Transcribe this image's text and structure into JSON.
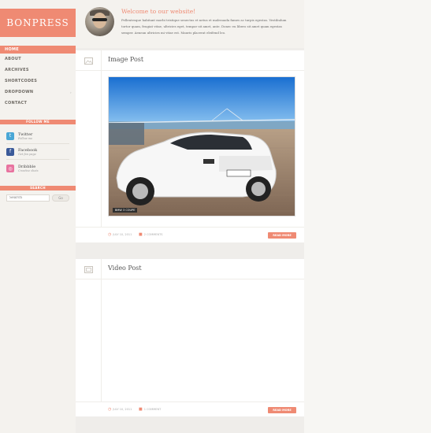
{
  "brand": {
    "logo": "BONPRESS",
    "accent": "#ef8a73"
  },
  "nav": {
    "items": [
      {
        "label": "HOME",
        "active": true
      },
      {
        "label": "ABOUT",
        "active": false
      },
      {
        "label": "ARCHIVES",
        "active": false
      },
      {
        "label": "SHORTCODES",
        "active": false
      },
      {
        "label": "DROPDOWN",
        "active": false,
        "has_children": true
      },
      {
        "label": "CONTACT",
        "active": false
      }
    ]
  },
  "follow": {
    "heading": "FOLLOW ME",
    "items": [
      {
        "name": "Twitter",
        "sub": "Follow me",
        "icon": "twitter-icon",
        "color": "#4aa7d6"
      },
      {
        "name": "Facebook",
        "sub": "Get fan page",
        "icon": "facebook-icon",
        "color": "#3b5a99"
      },
      {
        "name": "Dribbble",
        "sub": "Creative shots",
        "icon": "dribbble-icon",
        "color": "#e8739f"
      }
    ]
  },
  "search": {
    "heading": "SEARCH",
    "placeholder": "Search",
    "button": "Go"
  },
  "welcome": {
    "title": "Welcome to our website!",
    "text": "Pellentesque habitant morbi tristique senectus et netus et malesuada fames ac turpis egestas. Vestibulum tortor quam, feugiat vitae, ultricies eget, tempor sit amet, ante. Donec eu libero sit amet quam egestas semper. Aenean ultricies mi vitae est. Mauris placerat eleifend leo."
  },
  "posts": [
    {
      "title": "Image Post",
      "icon": "image-icon",
      "image_caption": "BMW 3 COUPE",
      "date": "JULY 10, 2011",
      "comments": "2 COMMENTS",
      "read_more": "READ MORE"
    },
    {
      "title": "Video Post",
      "icon": "video-icon",
      "date": "JULY 10, 2011",
      "comments": "1 COMMENT",
      "read_more": "READ MORE"
    }
  ]
}
